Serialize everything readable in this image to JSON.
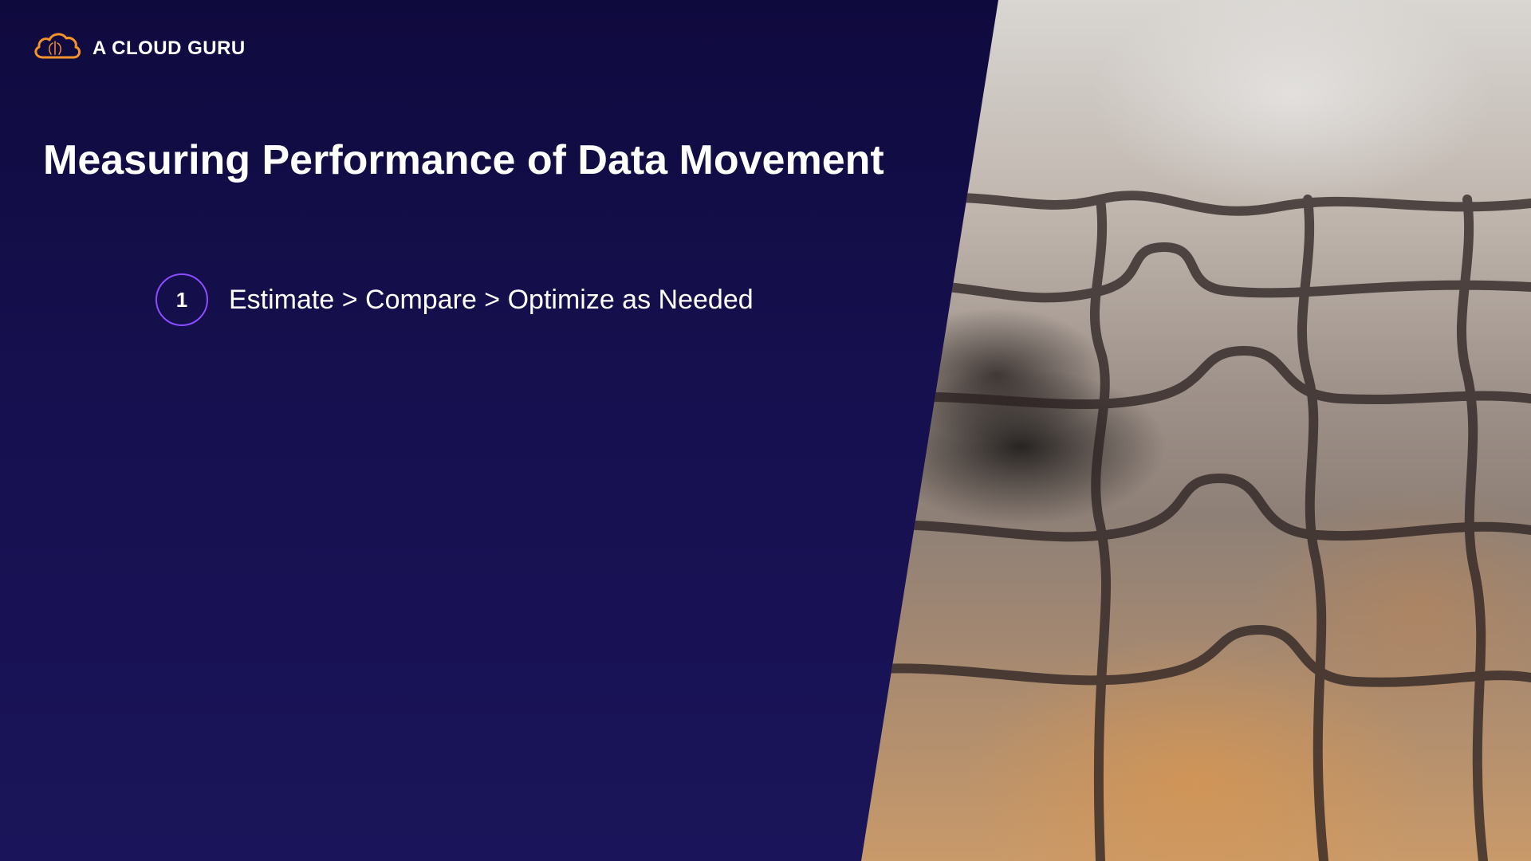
{
  "brand": {
    "name": "A CLOUD GURU",
    "logo_icon": "cloud-icon",
    "accent_color": "#f5922a"
  },
  "slide": {
    "title": "Measuring Performance of Data Movement",
    "background_color": "#140f45",
    "bullets": [
      {
        "number": "1",
        "text": "Estimate > Compare > Optimize as Needed",
        "ring_color": "#8a4dff"
      }
    ],
    "image": "jigsaw-puzzle-photo"
  }
}
